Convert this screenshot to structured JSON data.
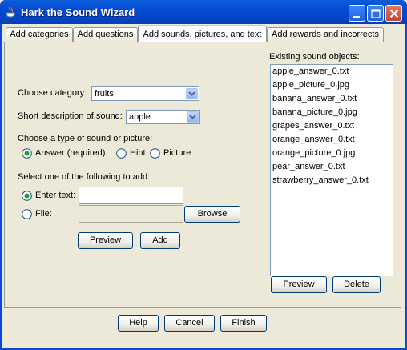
{
  "window": {
    "title": "Hark the Sound Wizard"
  },
  "tabs": [
    {
      "label": "Add categories",
      "active": false
    },
    {
      "label": "Add questions",
      "active": false
    },
    {
      "label": "Add sounds, pictures, and text",
      "active": true
    },
    {
      "label": "Add rewards and incorrects",
      "active": false
    }
  ],
  "form": {
    "category_label": "Choose category:",
    "category_value": "fruits",
    "short_desc_label": "Short description of sound:",
    "short_desc_value": "apple",
    "type_label": "Choose a type of sound or picture:",
    "type_options": [
      {
        "label": "Answer (required)",
        "selected": true
      },
      {
        "label": "Hint",
        "selected": false
      },
      {
        "label": "Picture",
        "selected": false
      }
    ],
    "add_label": "Select one of the following to add:",
    "enter_text_label": "Enter text:",
    "enter_text_value": "",
    "file_label": "File:",
    "file_value": "",
    "browse_label": "Browse",
    "preview_label": "Preview",
    "add_button_label": "Add"
  },
  "existing": {
    "label": "Existing sound objects:",
    "items": [
      "apple_answer_0.txt",
      "apple_picture_0.jpg",
      "banana_answer_0.txt",
      "banana_picture_0.jpg",
      "grapes_answer_0.txt",
      "orange_answer_0.txt",
      "orange_picture_0.jpg",
      "pear_answer_0.txt",
      "strawberry_answer_0.txt"
    ],
    "preview_label": "Preview",
    "delete_label": "Delete"
  },
  "footer": {
    "help_label": "Help",
    "cancel_label": "Cancel",
    "finish_label": "Finish"
  },
  "colors": {
    "title_bar": "#0449d4",
    "dialog_bg": "#ece9d8",
    "input_border": "#7f9db9",
    "radio_dot": "#21a121"
  }
}
